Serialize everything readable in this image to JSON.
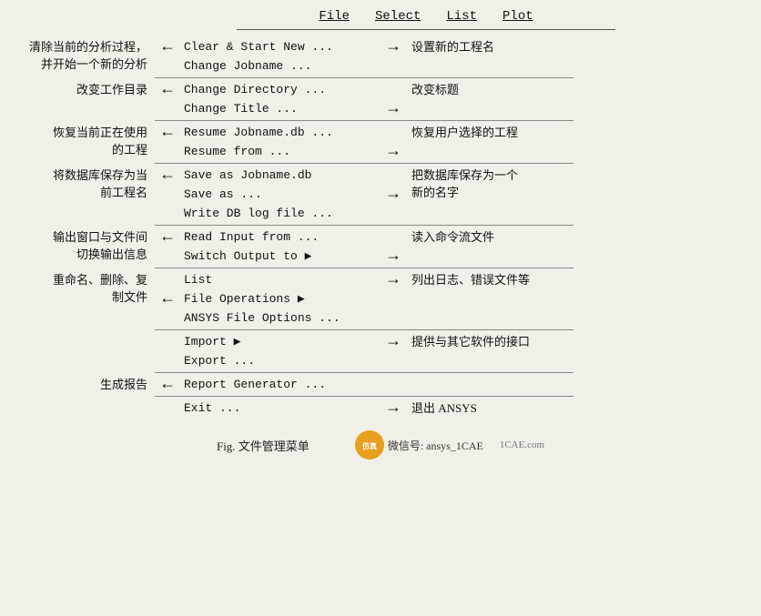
{
  "menu": {
    "items": [
      "File",
      "Select",
      "List",
      "Plot"
    ]
  },
  "groups": [
    {
      "id": "group1",
      "left_annotation": "清除当前的分析过程，\n并开始一个新的分析",
      "rows": [
        {
          "menu_text": "Clear & Start New ...",
          "has_left_arrow": true,
          "has_right_arrow": true,
          "right_annotation": "设置新的工程名"
        },
        {
          "menu_text": "Change Jobname ...",
          "has_left_arrow": false,
          "has_right_arrow": false,
          "right_annotation": ""
        }
      ]
    },
    {
      "id": "group2",
      "left_annotation": "改变工作目录",
      "rows": [
        {
          "menu_text": "Change Directory ...",
          "has_left_arrow": true,
          "has_right_arrow": false,
          "right_annotation": ""
        },
        {
          "menu_text": "Change Title ...",
          "has_left_arrow": false,
          "has_right_arrow": true,
          "right_annotation": "改变标题"
        }
      ]
    },
    {
      "id": "group3",
      "left_annotation": "恢复当前正在使用\n的工程",
      "rows": [
        {
          "menu_text": "Resume Jobname.db ...",
          "has_left_arrow": true,
          "has_right_arrow": false,
          "right_annotation": ""
        },
        {
          "menu_text": "Resume from ...",
          "has_left_arrow": false,
          "has_right_arrow": true,
          "right_annotation": "恢复用户选择的工程"
        }
      ]
    },
    {
      "id": "group4",
      "left_annotation": "将数据库保存为当\n前工程名",
      "rows": [
        {
          "menu_text": "Save as Jobname.db",
          "has_left_arrow": true,
          "has_right_arrow": false,
          "right_annotation": ""
        },
        {
          "menu_text": "Save as ...",
          "has_left_arrow": false,
          "has_right_arrow": true,
          "right_annotation": "把数据库保存为一个\n新的名字"
        },
        {
          "menu_text": "Write DB log file ...",
          "has_left_arrow": false,
          "has_right_arrow": false,
          "right_annotation": ""
        }
      ]
    },
    {
      "id": "group5",
      "left_annotation": "输出窗口与文件间\n切换输出信息",
      "rows": [
        {
          "menu_text": "Read Input from ...",
          "has_left_arrow": true,
          "has_right_arrow": false,
          "right_annotation": ""
        },
        {
          "menu_text": "Switch Output to  ▶",
          "has_left_arrow": false,
          "has_right_arrow": true,
          "right_annotation": "读入命令流文件"
        }
      ]
    },
    {
      "id": "group6",
      "left_annotation": "重命名、删除、复\n制文件",
      "rows": [
        {
          "menu_text": "List",
          "has_left_arrow": false,
          "has_right_arrow": true,
          "right_annotation": "列出日志、错误文件等"
        },
        {
          "menu_text": "File Operations      ▶",
          "has_left_arrow": true,
          "has_right_arrow": false,
          "right_annotation": ""
        },
        {
          "menu_text": "ANSYS File Options ...",
          "has_left_arrow": false,
          "has_right_arrow": false,
          "right_annotation": ""
        }
      ]
    },
    {
      "id": "group7",
      "left_annotation": "",
      "rows": [
        {
          "menu_text": "Import               ▶",
          "has_left_arrow": false,
          "has_right_arrow": true,
          "right_annotation": "提供与其它软件的接口"
        },
        {
          "menu_text": "Export ...",
          "has_left_arrow": false,
          "has_right_arrow": false,
          "right_annotation": ""
        }
      ]
    },
    {
      "id": "group8",
      "left_annotation": "生成报告",
      "rows": [
        {
          "menu_text": "Report Generator ...",
          "has_left_arrow": true,
          "has_right_arrow": false,
          "right_annotation": ""
        }
      ]
    },
    {
      "id": "group9",
      "left_annotation": "",
      "rows": [
        {
          "menu_text": "Exit ...",
          "has_left_arrow": false,
          "has_right_arrow": true,
          "right_annotation": "退出 ANSYS"
        }
      ]
    }
  ],
  "footer": {
    "title": "Fig. 文件管理菜单",
    "brand": "微信号: ansys_1CAE",
    "site": "1CAE.com"
  }
}
